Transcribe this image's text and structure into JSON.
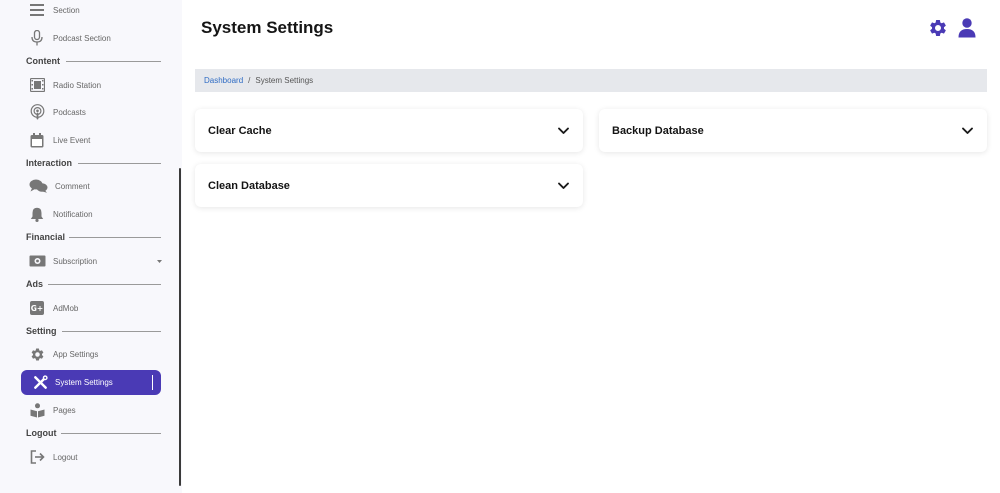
{
  "sidebar": {
    "items": {
      "section": "Section",
      "podcast_section": "Podcast Section",
      "radio_station": "Radio Station",
      "podcasts": "Podcasts",
      "live_event": "Live Event",
      "comment": "Comment",
      "notification": "Notification",
      "subscription": "Subscription",
      "admob": "AdMob",
      "app_settings": "App Settings",
      "system_settings": "System Settings",
      "pages": "Pages",
      "logout": "Logout"
    },
    "headings": {
      "content": "Content",
      "interaction": "Interaction",
      "financial": "Financial",
      "ads": "Ads",
      "setting": "Setting",
      "logout": "Logout"
    }
  },
  "header": {
    "title": "System Settings"
  },
  "breadcrumb": {
    "home": "Dashboard",
    "separator": "/",
    "current": "System Settings"
  },
  "cards": {
    "clear_cache": "Clear Cache",
    "backup_database": "Backup Database",
    "clean_database": "Clean Database"
  },
  "colors": {
    "accent": "#4a3ab5",
    "breadcrumb_link": "#2f6cc4",
    "breadcrumb_bg": "#e6e8ec"
  }
}
